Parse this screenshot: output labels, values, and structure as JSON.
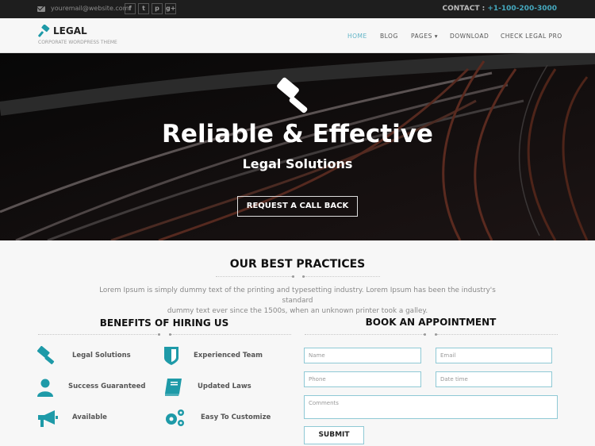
{
  "topbar": {
    "email": "youremail@website.com",
    "social": [
      {
        "icon": "facebook-icon",
        "glyph": "f"
      },
      {
        "icon": "twitter-icon",
        "glyph": "t"
      },
      {
        "icon": "pinterest-icon",
        "glyph": "p"
      },
      {
        "icon": "google-plus-icon",
        "glyph": "g+"
      }
    ],
    "contact_label": "CONTACT :",
    "contact_phone": "+1-100-200-3000"
  },
  "header": {
    "logo_title": "LEGAL",
    "logo_subtitle": "CORPORATE WORDPRESS THEME",
    "nav": [
      {
        "label": "HOME",
        "active": true
      },
      {
        "label": "BLOG"
      },
      {
        "label": "PAGES ▾"
      },
      {
        "label": "DOWNLOAD"
      },
      {
        "label": "CHECK LEGAL PRO"
      }
    ]
  },
  "hero": {
    "title": "Reliable & Effective",
    "subtitle": "Legal Solutions",
    "button_label": "REQUEST A CALL BACK"
  },
  "practices": {
    "title": "OUR BEST PRACTICES",
    "lead_line1": "Lorem Ipsum is simply dummy text of the printing and typesetting industry. Lorem Ipsum has been the industry's standard",
    "lead_line2": "dummy text ever since the 1500s, when an unknown printer took a galley."
  },
  "benefits": {
    "title": "BENEFITS OF HIRING US",
    "items": [
      {
        "label": "Legal Solutions",
        "icon": "gavel-icon"
      },
      {
        "label": "Experienced Team",
        "icon": "shield-icon"
      },
      {
        "label": "Success Guaranteed",
        "icon": "user-icon"
      },
      {
        "label": "Updated Laws",
        "icon": "book-icon"
      },
      {
        "label": "Available",
        "icon": "megaphone-icon"
      },
      {
        "label": "Easy To Customize",
        "icon": "gears-icon"
      }
    ]
  },
  "appointment": {
    "title": "BOOK AN APPOINTMENT",
    "name_placeholder": "Name",
    "email_placeholder": "Email",
    "phone_placeholder": "Phone",
    "datetime_placeholder": "Date time",
    "comments_placeholder": "Comments",
    "submit_label": "SUBMIT"
  },
  "colors": {
    "accent": "#1e9aa8",
    "link": "#45a9bf",
    "topbar_bg": "#1e1e1e"
  }
}
